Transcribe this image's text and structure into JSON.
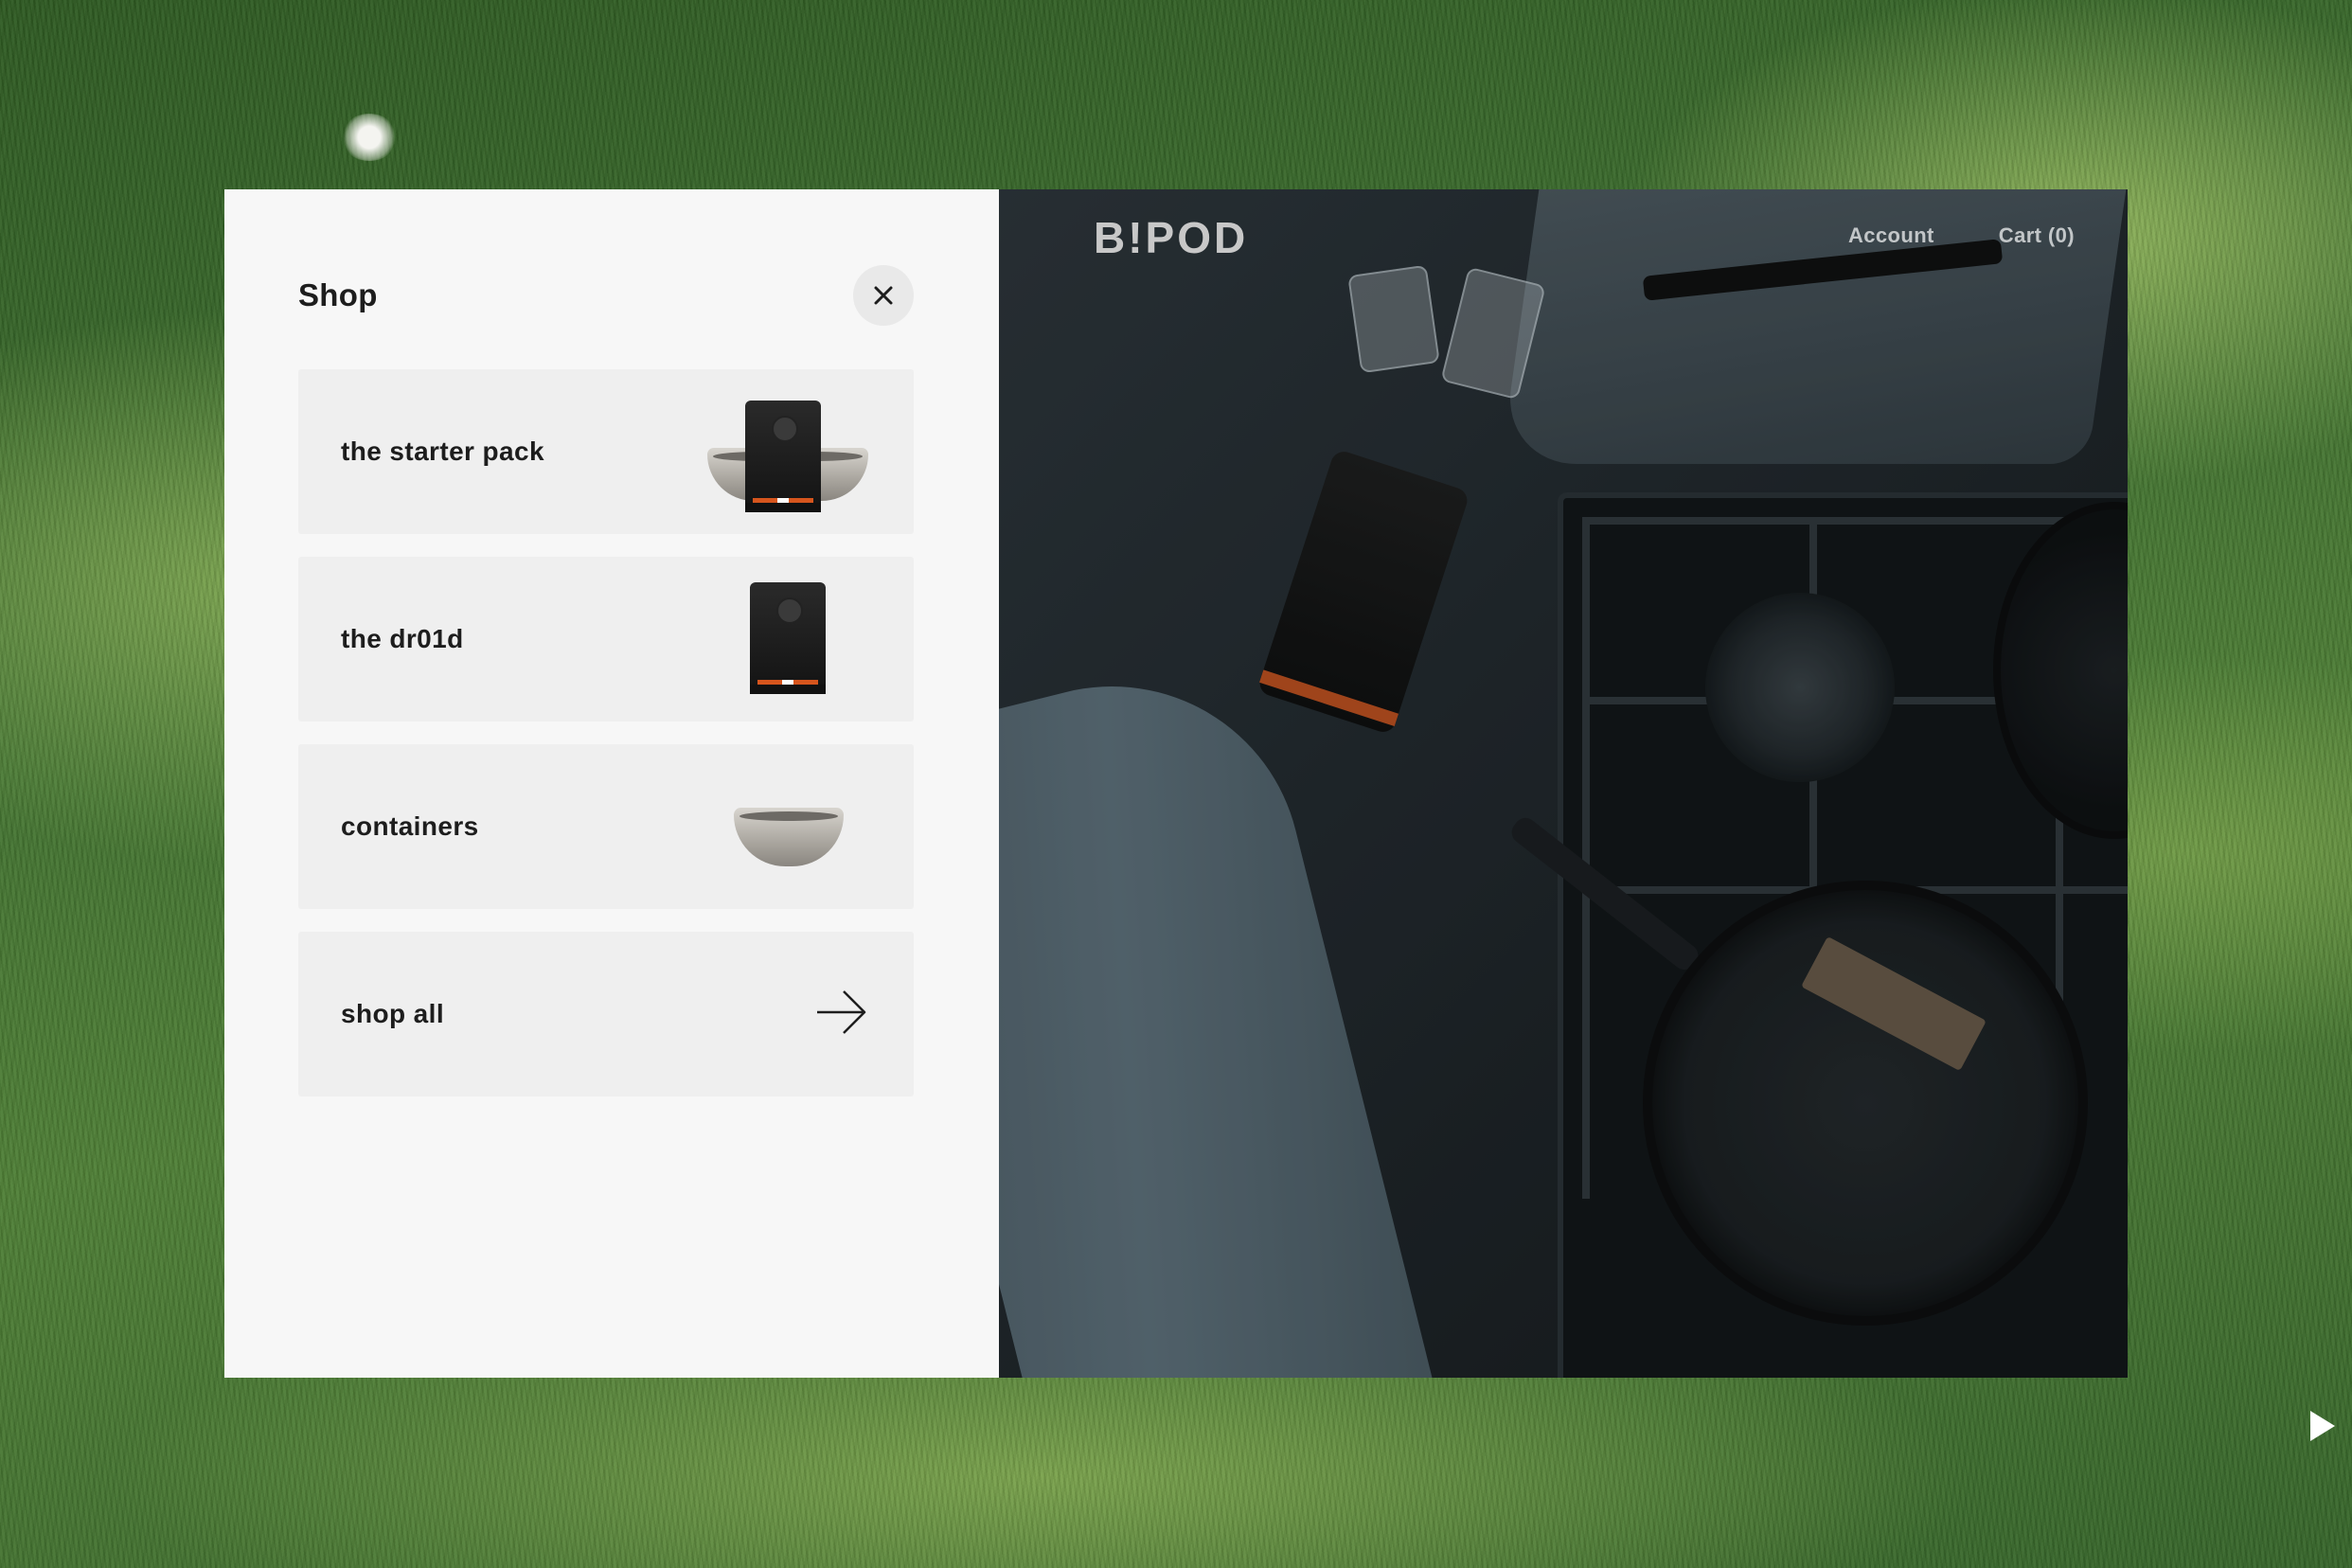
{
  "panel": {
    "title": "Shop",
    "close_icon": "close-icon",
    "items": [
      {
        "label": "the starter pack",
        "thumb": "starter-pack-image"
      },
      {
        "label": "the dr01d",
        "thumb": "droid-image"
      },
      {
        "label": "containers",
        "thumb": "container-image"
      },
      {
        "label": "shop all",
        "thumb": "arrow-right-icon"
      }
    ]
  },
  "header": {
    "brand": "B!POD",
    "nav": {
      "account": "Account",
      "cart": "Cart (0)"
    }
  },
  "colors": {
    "panel_bg": "#f7f7f7",
    "item_bg": "#efefef",
    "text": "#1d1d1d",
    "accent_orange": "#d6551d",
    "nav_text": "#c2c6c8"
  },
  "background": {
    "play_icon": "play-icon"
  }
}
